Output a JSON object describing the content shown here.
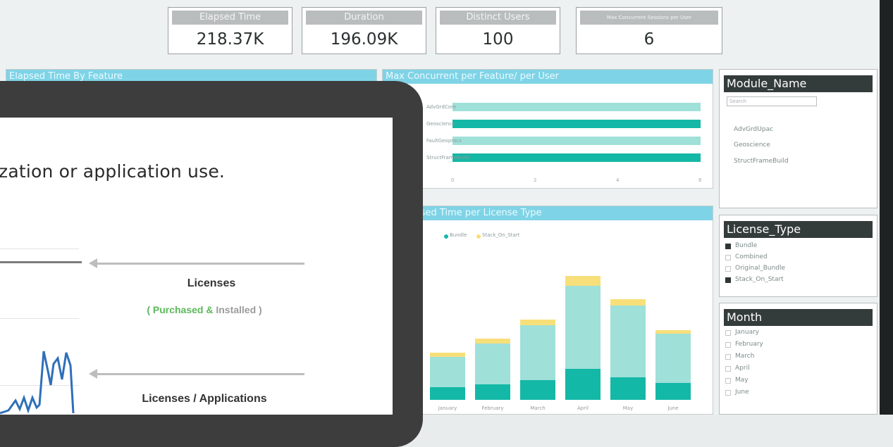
{
  "colors": {
    "accent": "#7fd3e6",
    "teal_dark": "#14b8a6",
    "teal_light": "#9fe0d9",
    "yellow": "#f7df7a",
    "green": "#5cb85c",
    "gray_text": "#9b9b9b"
  },
  "kpis": [
    {
      "label": "Elapsed Time",
      "value": "218.37K"
    },
    {
      "label": "Duration",
      "value": "196.09K"
    },
    {
      "label": "Distinct Users",
      "value": "100"
    },
    {
      "label": "Max Concurrent Sessions per User",
      "value": "6"
    }
  ],
  "panels": {
    "elapsed_by_feature": "Elapsed Time By Feature",
    "max_concurrent": "Max Concurrent per Feature/ per User",
    "elapsed_license": "ics Elapsed Time per License Type"
  },
  "hbar_chart": {
    "labels": [
      "AdvGrdCore",
      "Geoscience",
      "FaultGeoprocs",
      "StructFrameBuild"
    ],
    "values": [
      6,
      6,
      6,
      6
    ],
    "ticks": [
      "0",
      "2",
      "4",
      "6"
    ]
  },
  "vbar_chart": {
    "legend": [
      "Bundle",
      "Stack_On_Start"
    ],
    "months": [
      "January",
      "February",
      "March",
      "April",
      "May",
      "June"
    ],
    "dark": [
      18,
      22,
      28,
      44,
      32,
      24
    ],
    "light": [
      43,
      58,
      78,
      118,
      102,
      70
    ],
    "yellow": [
      6,
      7,
      8,
      14,
      9,
      5
    ]
  },
  "slicers": {
    "module": {
      "title": "Module_Name",
      "search_placeholder": "Search",
      "items": [
        "AdvGrdUpac",
        "Geoscience",
        "StructFrameBuild"
      ]
    },
    "license": {
      "title": "License_Type",
      "items": [
        {
          "label": "Bundle",
          "checked": true
        },
        {
          "label": "Combined",
          "checked": false
        },
        {
          "label": "Original_Bundle",
          "checked": false
        },
        {
          "label": "Stack_On_Start",
          "checked": true
        }
      ]
    },
    "month": {
      "title": "Month",
      "items": [
        "January",
        "February",
        "March",
        "April",
        "May",
        "June"
      ]
    }
  },
  "tablet": {
    "headline": "zation or application use.",
    "annotation1_title": "Licenses",
    "annotation1_purchased": "( Purchased &",
    "annotation1_installed": " Installed )",
    "annotation2_title": "Licenses / Applications"
  }
}
